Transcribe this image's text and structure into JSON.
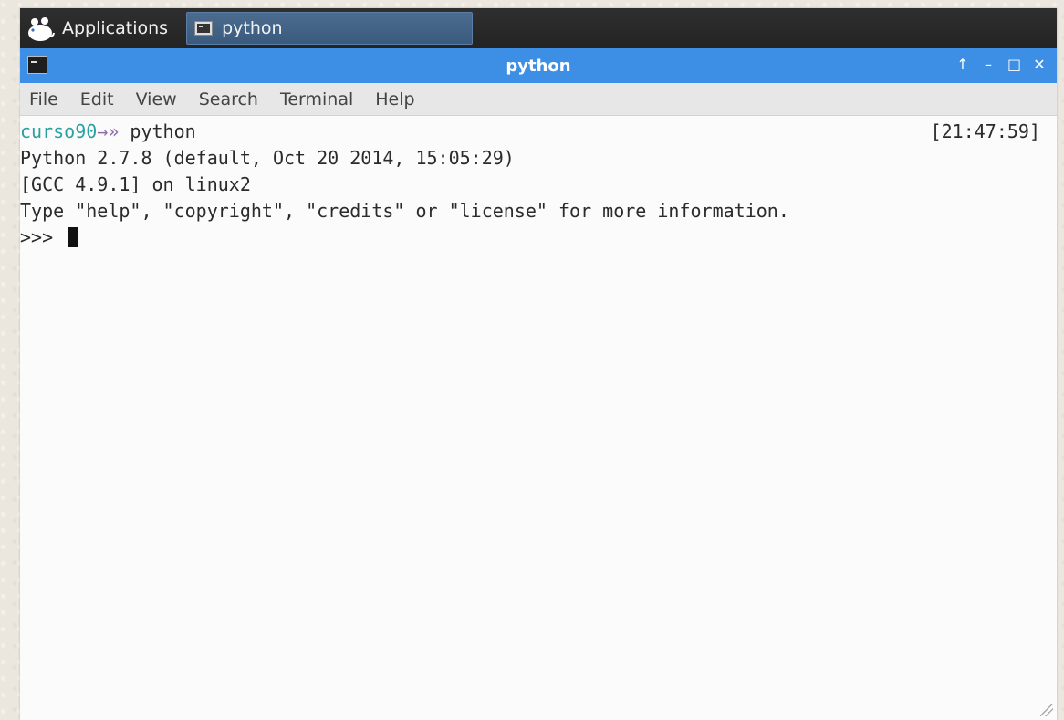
{
  "taskbar": {
    "applications_label": "Applications",
    "task_label": "python"
  },
  "window": {
    "title": "python",
    "controls": [
      "↑",
      "–",
      "□",
      "✕"
    ]
  },
  "menu": [
    "File",
    "Edit",
    "View",
    "Search",
    "Terminal",
    "Help"
  ],
  "terminal": {
    "prompt_user": "curso90",
    "prompt_arrow": "→»",
    "command": " python",
    "timestamp": "[21:47:59]",
    "lines": [
      "Python 2.7.8 (default, Oct 20 2014, 15:05:29)",
      "[GCC 4.9.1] on linux2",
      "Type \"help\", \"copyright\", \"credits\" or \"license\" for more information."
    ],
    "repl_prompt": ">>> "
  },
  "colors": {
    "titlebar": "#3d8fe6",
    "prompt_user": "#2aa1a1",
    "taskbar": "#2f2f2f"
  }
}
